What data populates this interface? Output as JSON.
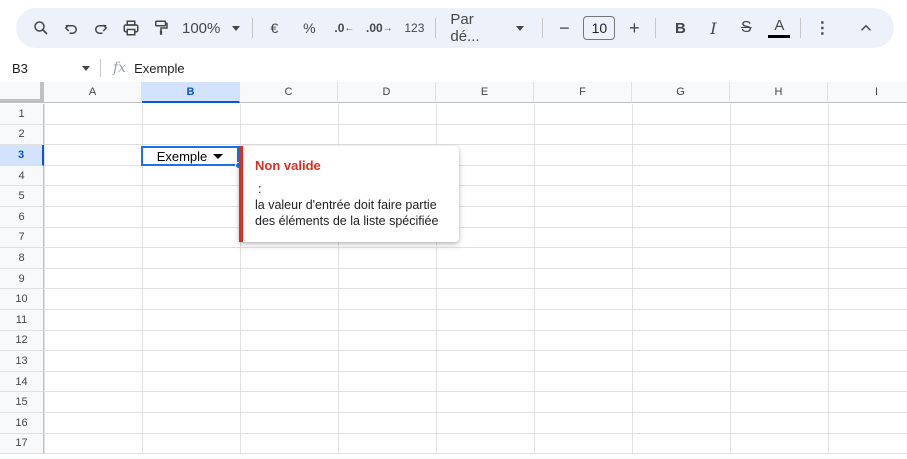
{
  "toolbar": {
    "zoom": "100%",
    "currency": "€",
    "percent": "%",
    "decrease_decimal": ".0",
    "increase_decimal": ".00",
    "number_format": "123",
    "font_family": "Par dé...",
    "font_size": "10",
    "bold": "B",
    "italic": "I",
    "strikethrough": "S",
    "text_color": "A",
    "minus": "−",
    "plus": "+",
    "more": "⋮",
    "collapse": "⌃"
  },
  "formula_bar": {
    "cell_ref": "B3",
    "fx": "fx",
    "value": "Exemple"
  },
  "columns": [
    "A",
    "B",
    "C",
    "D",
    "E",
    "F",
    "G",
    "H",
    "I"
  ],
  "rows": [
    "1",
    "2",
    "3",
    "4",
    "5",
    "6",
    "7",
    "8",
    "9",
    "10",
    "11",
    "12",
    "13",
    "14",
    "15",
    "16",
    "17"
  ],
  "active_cell": {
    "ref": "B3",
    "value": "Exemple"
  },
  "validation_tooltip": {
    "title": "Non valide",
    "colon": ":",
    "message": "la valeur d'entrée doit faire partie des éléments de la liste spécifiée"
  }
}
